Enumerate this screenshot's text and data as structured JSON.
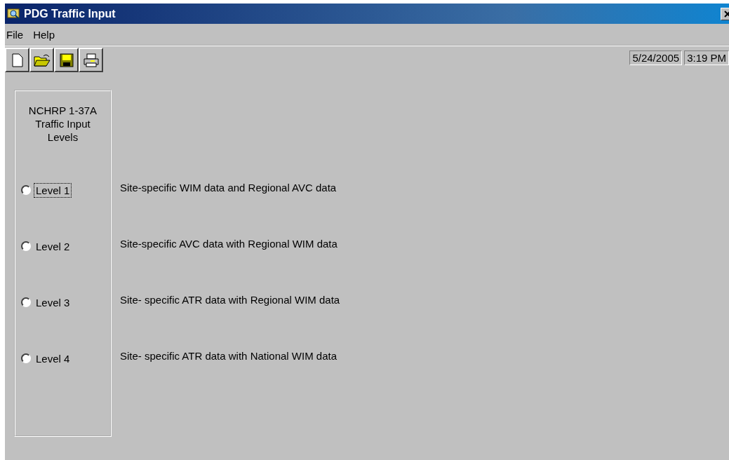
{
  "window": {
    "title": "PDG Traffic Input"
  },
  "menu": [
    "File",
    "Help"
  ],
  "status": {
    "date": "5/24/2005",
    "time": "3:19 PM"
  },
  "group": {
    "title": "NCHRP 1-37A\nTraffic Input\nLevels"
  },
  "levels": [
    {
      "label": "Level 1",
      "description": "Site-specific WIM data and Regional AVC data",
      "selected": false,
      "focused": true
    },
    {
      "label": "Level 2",
      "description": "Site-specific AVC data with Regional WIM data",
      "selected": false,
      "focused": false
    },
    {
      "label": "Level 3",
      "description": "Site- specific ATR data with Regional WIM data",
      "selected": false,
      "focused": false
    },
    {
      "label": "Level 4",
      "description": "Site- specific ATR data with National WIM data",
      "selected": false,
      "focused": false
    }
  ]
}
